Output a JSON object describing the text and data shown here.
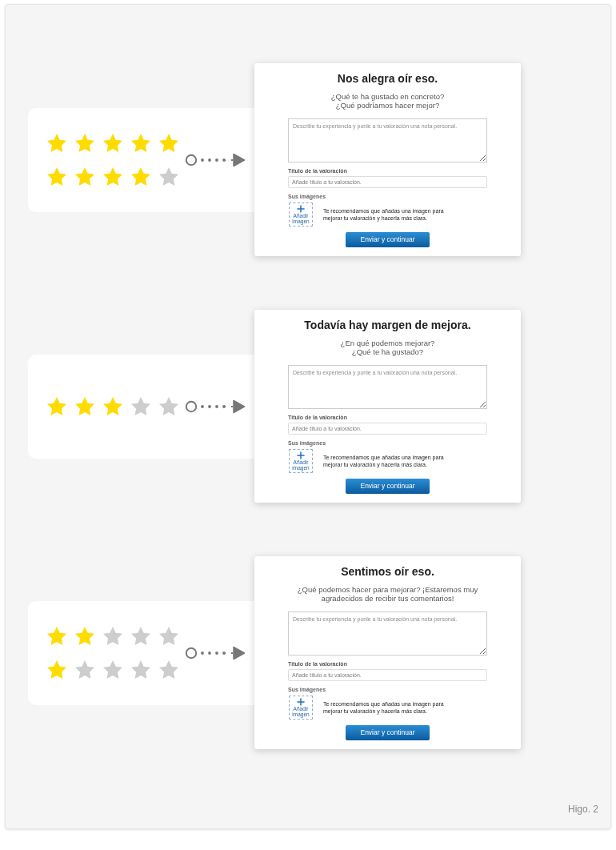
{
  "sections": [
    {
      "star_rows": [
        {
          "stars": 5
        },
        {
          "stars": 4
        }
      ],
      "card": {
        "title": "Nos alegra oír eso.",
        "subtitle_lines": [
          "¿Qué te ha gustado en concreto?",
          "¿Qué podríamos hacer mejor?"
        ],
        "comment_field": {
          "placeholder": "Describe tu experiencia y ponle a tu valoración una nota personal."
        },
        "title_field": {
          "label": "Título de la valoración",
          "placeholder": "Añade título a tu valoración."
        },
        "images": {
          "label": "Sus imágenes",
          "add_button": "Añadir imagen",
          "hint": "Te recomendamos que añadas una imagen para mejorar tu valoración y hacerla más clara."
        },
        "submit_button": "Enviar y continuar"
      }
    },
    {
      "star_rows": [
        {
          "stars": 3
        }
      ],
      "card": {
        "title": "Todavía hay margen de mejora.",
        "subtitle_lines": [
          "¿En qué podemos mejorar?",
          "¿Qué te ha gustado?"
        ],
        "comment_field": {
          "placeholder": "Describe tu experiencia y ponle a tu valoración una nota personal."
        },
        "title_field": {
          "label": "Título de la valoración",
          "placeholder": "Añade título a tu valoración."
        },
        "images": {
          "label": "Sus imágenes",
          "add_button": "Añadir imagen",
          "hint": "Te recomendamos que añadas una imagen para mejorar tu valoración y hacerla más clara."
        },
        "submit_button": "Enviar y continuar"
      }
    },
    {
      "star_rows": [
        {
          "stars": 2
        },
        {
          "stars": 1
        }
      ],
      "card": {
        "title": "Sentimos oír eso.",
        "subtitle_lines": [
          "¿Qué podemos hacer para mejorar? ¡Estaremos muy agradecidos de recibir tus comentarios!"
        ],
        "comment_field": {
          "placeholder": "Describe tu experiencia y ponle a tu valoración una nota personal."
        },
        "title_field": {
          "label": "Título de la valoración",
          "placeholder": "Añade título a tu valoración."
        },
        "images": {
          "label": "Sus imágenes",
          "add_button": "Añadir imagen",
          "hint": "Te recomendamos que añadas una imagen para mejorar tu valoración y hacerla más clara."
        },
        "submit_button": "Enviar y continuar"
      }
    }
  ],
  "figure_label": "Higo. 2"
}
